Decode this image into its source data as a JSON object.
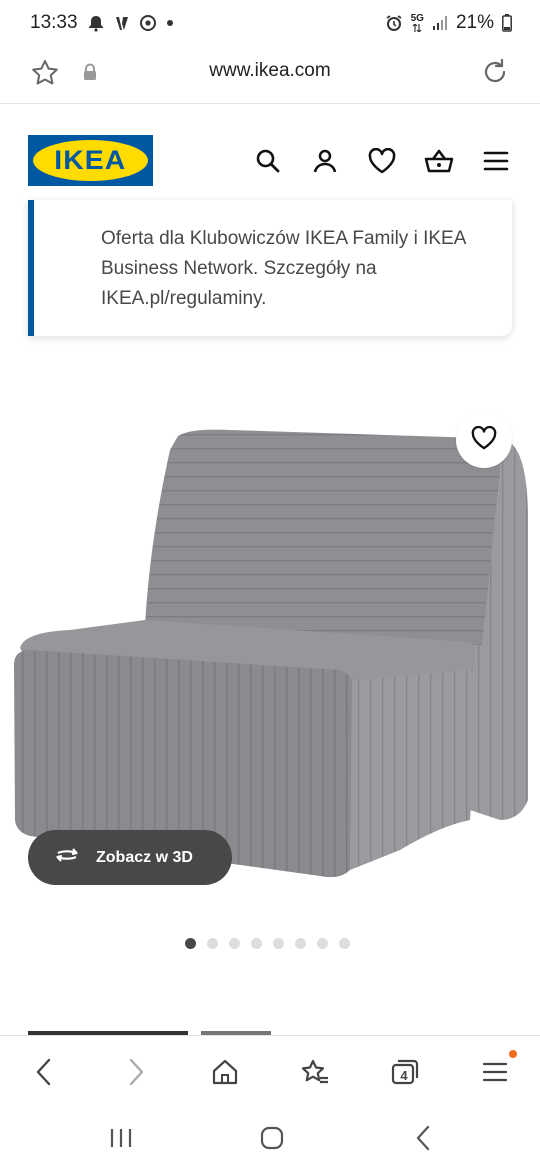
{
  "status_bar": {
    "time": "13:33",
    "network": "5G",
    "battery": "21%"
  },
  "browser": {
    "url": "www.ikea.com",
    "tabs_count": "4"
  },
  "site": {
    "logo_text": "IKEA",
    "brand_blue": "#0058a3",
    "brand_yellow": "#ffdb00"
  },
  "promo": {
    "text": "Oferta dla Klubowiczów IKEA Family i IKEA Business Network. Szczegóły na IKEA.pl/regulaminy."
  },
  "product": {
    "view_3d_label": "Zobacz w 3D",
    "image_count": 8,
    "active_image": 0
  }
}
